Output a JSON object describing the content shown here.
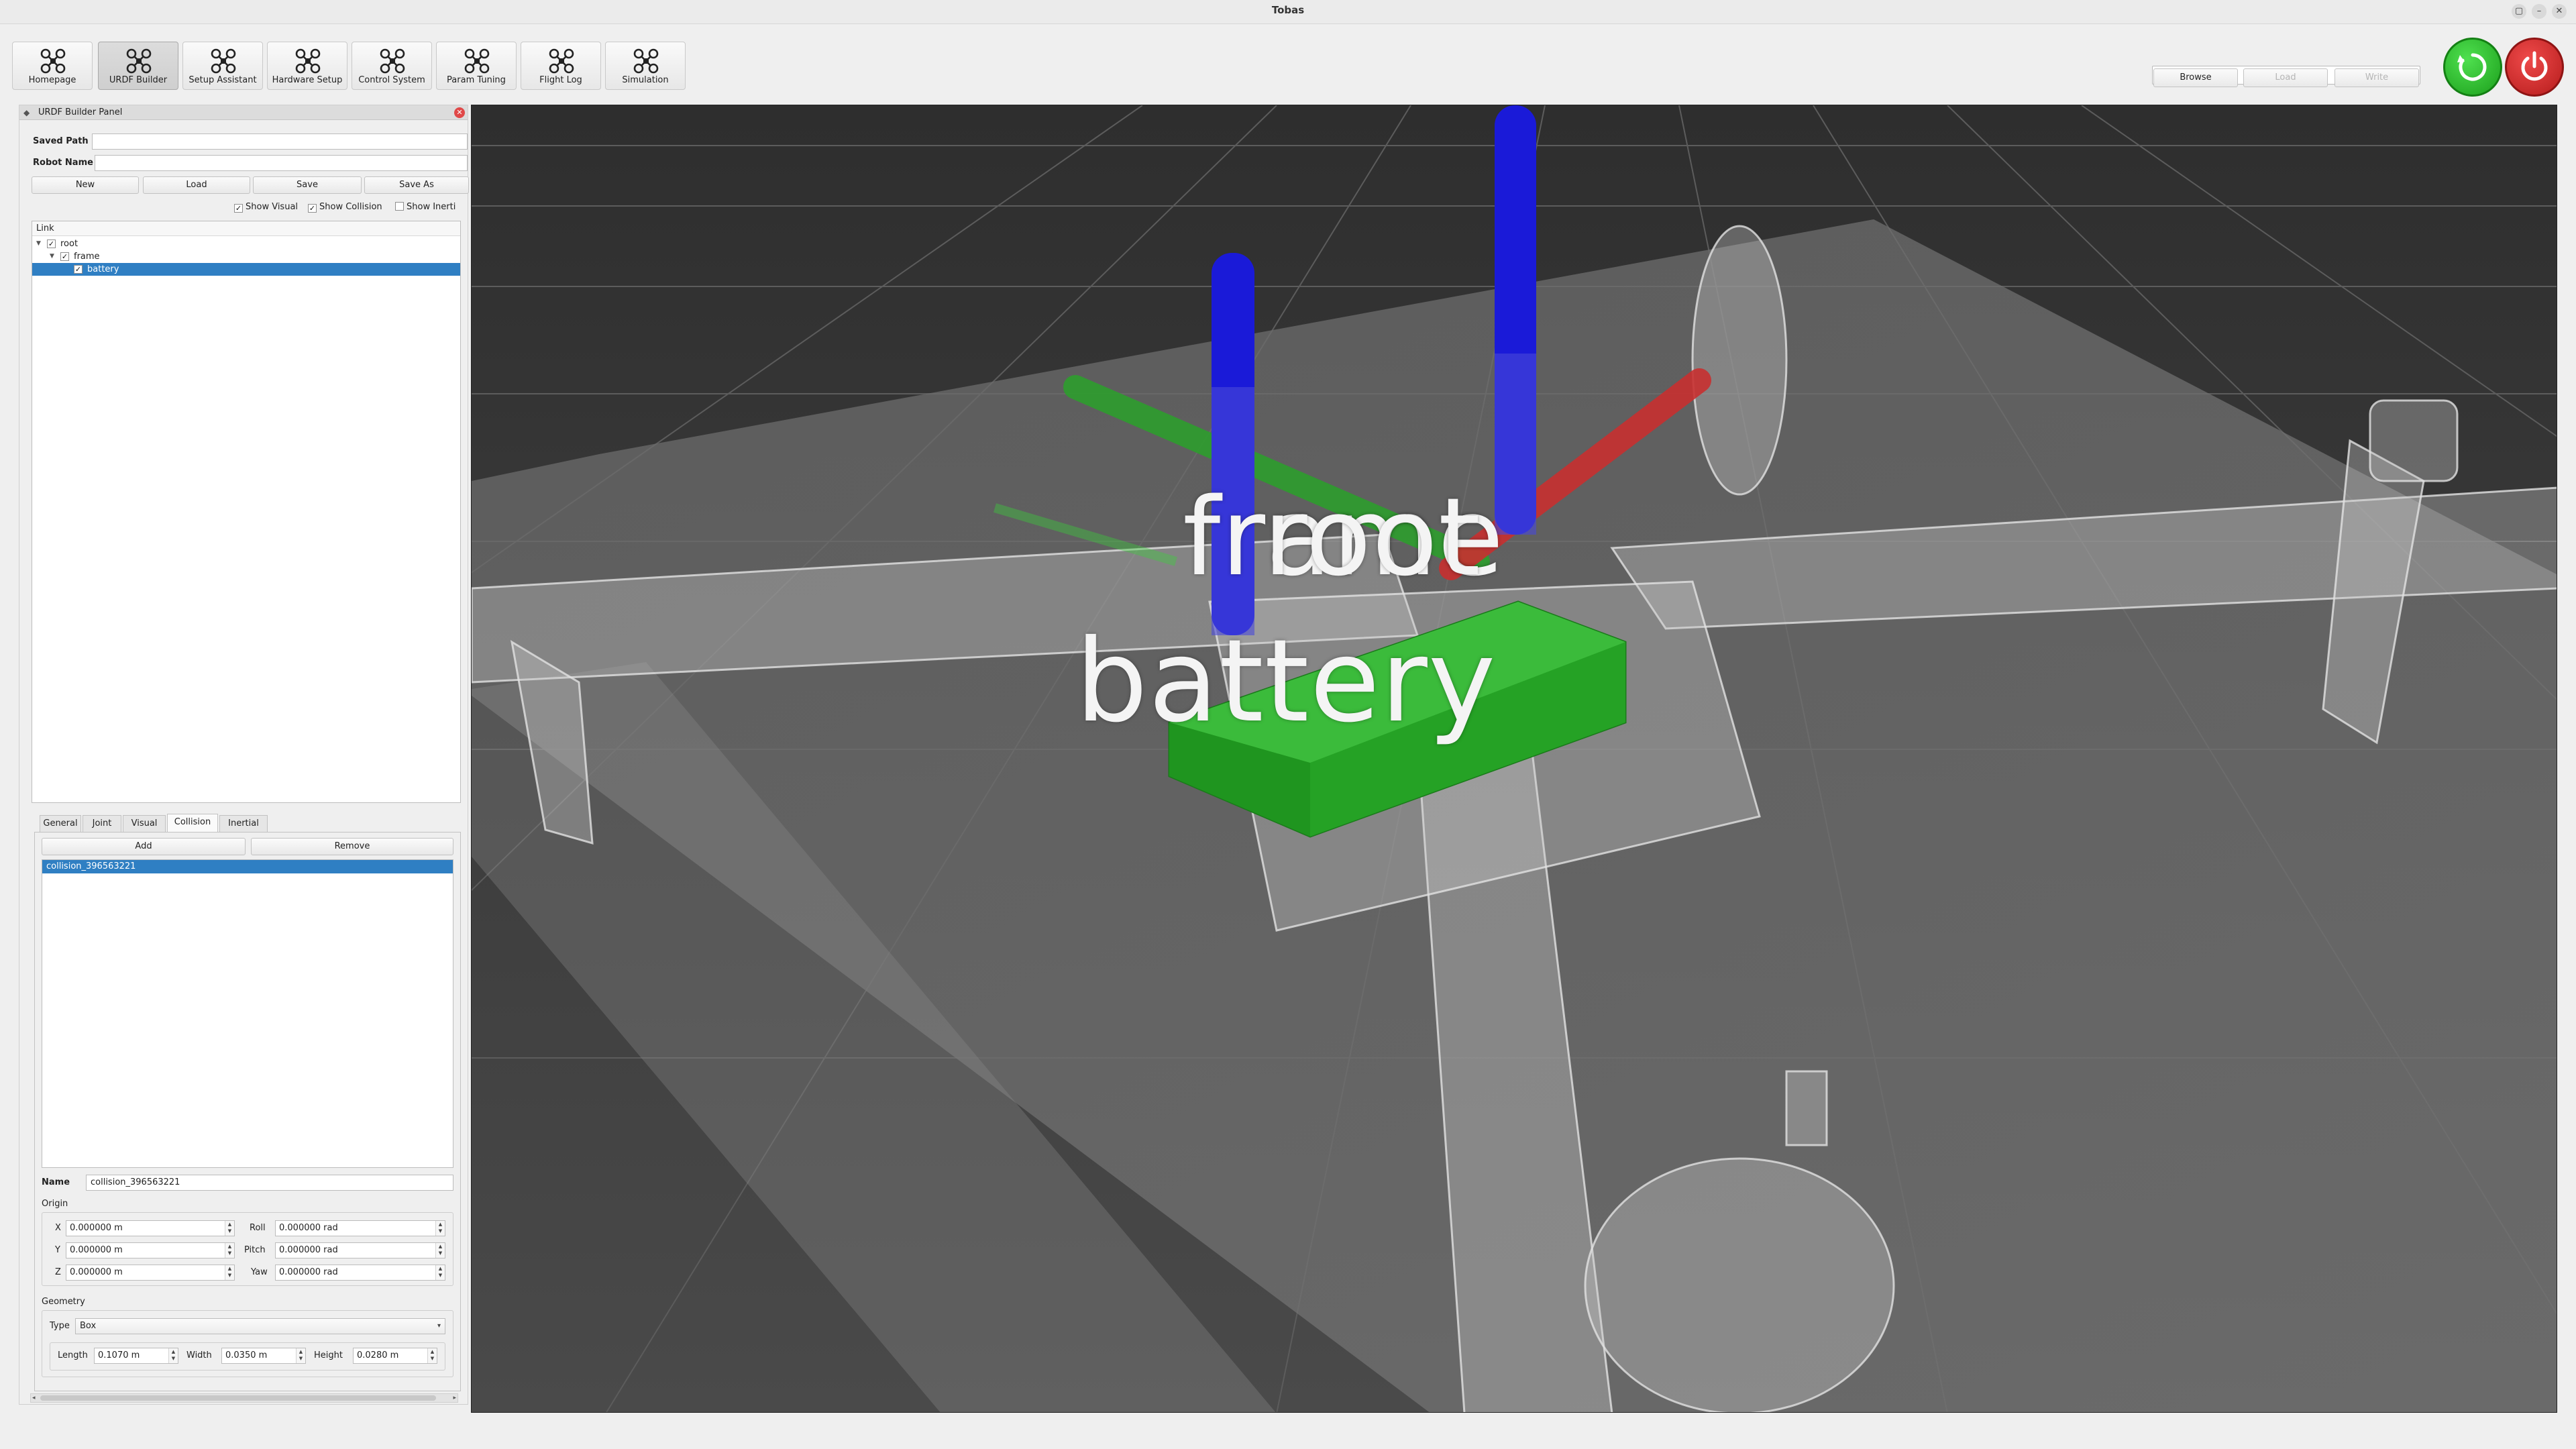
{
  "window": {
    "title": "Tobas"
  },
  "toolbar": {
    "buttons": [
      {
        "label": "Homepage",
        "icon": "drone-icon",
        "active": false
      },
      {
        "label": "URDF Builder",
        "icon": "drone-icon",
        "active": true
      },
      {
        "label": "Setup Assistant",
        "icon": "drone-icon",
        "active": false
      },
      {
        "label": "Hardware Setup",
        "icon": "drone-icon",
        "active": false
      },
      {
        "label": "Control System",
        "icon": "drone-icon",
        "active": false
      },
      {
        "label": "Param Tuning",
        "icon": "drone-icon",
        "active": false
      },
      {
        "label": "Flight Log",
        "icon": "drone-icon",
        "active": false
      },
      {
        "label": "Simulation",
        "icon": "drone-icon",
        "active": false
      }
    ],
    "path_value": "",
    "browse_label": "Browse",
    "load_label": "Load",
    "write_label": "Write",
    "colors": {
      "restart": "#22b222",
      "power": "#d42424"
    }
  },
  "panel": {
    "title": "URDF Builder Panel",
    "saved_path_label": "Saved Path",
    "saved_path_value": "",
    "robot_name_label": "Robot Name",
    "robot_name_value": "",
    "new_label": "New",
    "load_label": "Load",
    "save_label": "Save",
    "save_as_label": "Save As",
    "show_visual_label": "Show Visual",
    "show_collision_label": "Show Collision",
    "show_inertia_label": "Show Inerti",
    "show_visual_checked": true,
    "show_collision_checked": true,
    "show_inertia_checked": false,
    "tree": {
      "header": "Link",
      "items": [
        {
          "label": "root",
          "level": 0,
          "checked": true,
          "selected": false
        },
        {
          "label": "frame",
          "level": 1,
          "checked": true,
          "selected": false
        },
        {
          "label": "battery",
          "level": 2,
          "checked": true,
          "selected": true
        }
      ]
    },
    "tabs": [
      "General",
      "Joint",
      "Visual",
      "Collision",
      "Inertial"
    ],
    "active_tab": "Collision",
    "collision": {
      "add_label": "Add",
      "remove_label": "Remove",
      "items": [
        "collision_396563221"
      ],
      "name_label": "Name",
      "name_value": "collision_396563221",
      "origin_label": "Origin",
      "x_label": "X",
      "x_value": "0.000000 m",
      "y_label": "Y",
      "y_value": "0.000000 m",
      "z_label": "Z",
      "z_value": "0.000000 m",
      "roll_label": "Roll",
      "roll_value": "0.000000 rad",
      "pitch_label": "Pitch",
      "pitch_value": "0.000000 rad",
      "yaw_label": "Yaw",
      "yaw_value": "0.000000 rad",
      "geometry_label": "Geometry",
      "type_label": "Type",
      "type_value": "Box",
      "length_label": "Length",
      "length_value": "0.1070 m",
      "width_label": "Width",
      "width_value": "0.0350 m",
      "height_label": "Height",
      "height_value": "0.0280 m"
    }
  },
  "viewport": {
    "labels": {
      "frame": "frame",
      "root": "root",
      "battery": "battery"
    },
    "colors": {
      "background": "#3b3b3b",
      "collision_box": "#1fa81f",
      "x_axis": "#c83030",
      "y_axis": "#2e9e2e",
      "z_axis": "#1a1ad8"
    }
  }
}
